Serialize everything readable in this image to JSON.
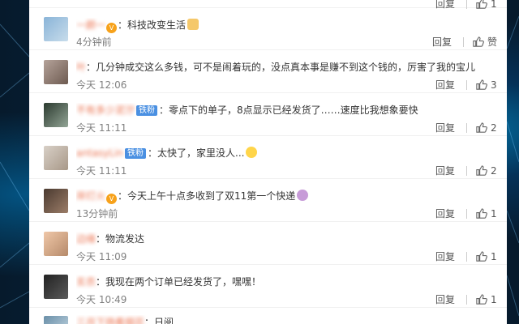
{
  "top": {
    "reply": "回复",
    "like_count": "1"
  },
  "comments": [
    {
      "user": "一颜一",
      "vip": true,
      "fan": "",
      "text": "：科技改变生活",
      "emoji": "thumb",
      "time": "4分钟前",
      "reply": "回复",
      "like": "赞",
      "like_count": ""
    },
    {
      "user": "叶",
      "vip": false,
      "fan": "",
      "text": "：几分钟成交这么多钱，可不是闹着玩的，没点真本事是赚不到这个钱的，厉害了我的宝儿",
      "emoji": "",
      "time": "今天 12:06",
      "reply": "回复",
      "like": "",
      "like_count": "3"
    },
    {
      "user": "不有多少泥泞",
      "vip": false,
      "fan": "铁粉",
      "text": "：零点下的单子，8点显示已经发货了……速度比我想象要快",
      "emoji": "",
      "time": "今天 11:11",
      "reply": "回复",
      "like": "",
      "like_count": "2"
    },
    {
      "user": "antasyLin",
      "vip": false,
      "fan": "铁粉",
      "text": "：太快了，家里没人...",
      "emoji": "face",
      "time": "今天 11:11",
      "reply": "回复",
      "like": "",
      "like_count": "2"
    },
    {
      "user": "岸灯火",
      "vip": true,
      "fan": "",
      "text": "：今天上午十点多收到了双11第一个快递",
      "emoji": "face",
      "time": "13分钟前",
      "reply": "回复",
      "like": "",
      "like_count": "1"
    },
    {
      "user": "边缘",
      "vip": false,
      "fan": "",
      "text": "：物流发达",
      "emoji": "",
      "time": "今天 11:09",
      "reply": "回复",
      "like": "",
      "like_count": "1"
    },
    {
      "user": "玄衣",
      "vip": false,
      "fan": "",
      "text": "：我现在两个订单已经发货了，嘿嘿！",
      "emoji": "",
      "time": "今天 10:49",
      "reply": "回复",
      "like": "",
      "like_count": "1"
    },
    {
      "user": "三月下扬看烟花",
      "vip": false,
      "fan": "",
      "text": "：日阅",
      "emoji": "",
      "time": "",
      "reply": "",
      "like": "",
      "like_count": ""
    }
  ],
  "colors": {
    "username": "#eb7350",
    "fan_badge": "#4a90e2",
    "vip_badge": "#f7a21b"
  }
}
